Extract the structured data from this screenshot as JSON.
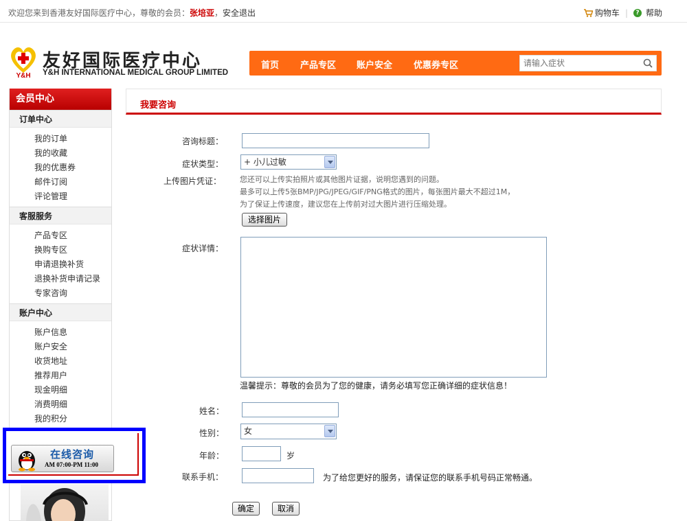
{
  "topbar": {
    "welcome": "欢迎您来到香港友好国际医疗中心，尊敬的会员：",
    "username": "张培亚",
    "comma": "，",
    "logout": "安全退出",
    "cart": "购物车",
    "help": "帮助"
  },
  "logo": {
    "cn": "友好国际医疗中心",
    "en": "Y&H INTERNATIONAL MEDICAL GROUP LIMITED",
    "mark_text": "Y&H"
  },
  "nav": {
    "items": [
      "首页",
      "产品专区",
      "账户安全",
      "优惠券专区"
    ],
    "search_placeholder": "请输入症状"
  },
  "sidebar": {
    "title": "会员中心",
    "groups": [
      {
        "title": "订单中心",
        "items": [
          "我的订单",
          "我的收藏",
          "我的优惠券",
          "邮件订阅",
          "评论管理"
        ]
      },
      {
        "title": "客服服务",
        "items": [
          "产品专区",
          "换购专区",
          "申请退换补货",
          "退换补货申请记录",
          "专家咨询"
        ]
      },
      {
        "title": "账户中心",
        "items": [
          "账户信息",
          "账户安全",
          "收货地址",
          "推荐用户",
          "现金明细",
          "消费明细",
          "我的积分"
        ]
      }
    ],
    "qq_title": "在线咨询",
    "qq_hours": "AM 07:00-PM 11:00"
  },
  "main": {
    "title": "我要咨询",
    "form": {
      "subject_label": "咨询标题：",
      "subject_value": "",
      "symptom_type_label": "症状类型：",
      "symptom_type_value": "+ 小儿过敏",
      "upload_label": "上传图片凭证：",
      "upload_hint_1": "您还可以上传实拍照片或其他图片证据，说明您遇到的问题。",
      "upload_hint_2": "最多可以上传5张BMP/JPG/JPEG/GIF/PNG格式的图片，每张图片最大不超过1M，",
      "upload_hint_3": "为了保证上传速度，建议您在上传前对过大图片进行压缩处理。",
      "choose_image": "选择图片",
      "detail_label": "症状详情：",
      "detail_value": "",
      "detail_tip": "温馨提示：尊敬的会员为了您的健康，请务必填写您正确详细的症状信息！",
      "name_label": "姓名：",
      "name_value": "",
      "gender_label": "性别：",
      "gender_value": "女",
      "age_label": "年龄：",
      "age_value": "",
      "age_unit": "岁",
      "phone_label": "联系手机：",
      "phone_value": "",
      "phone_tip": "为了给您更好的服务，请保证您的联系手机号码正常畅通。",
      "confirm": "确定",
      "cancel": "取消"
    }
  },
  "colors": {
    "nav_orange": "#ff6a13",
    "brand_red": "#cc0000",
    "highlight_border": "#0000ff"
  }
}
